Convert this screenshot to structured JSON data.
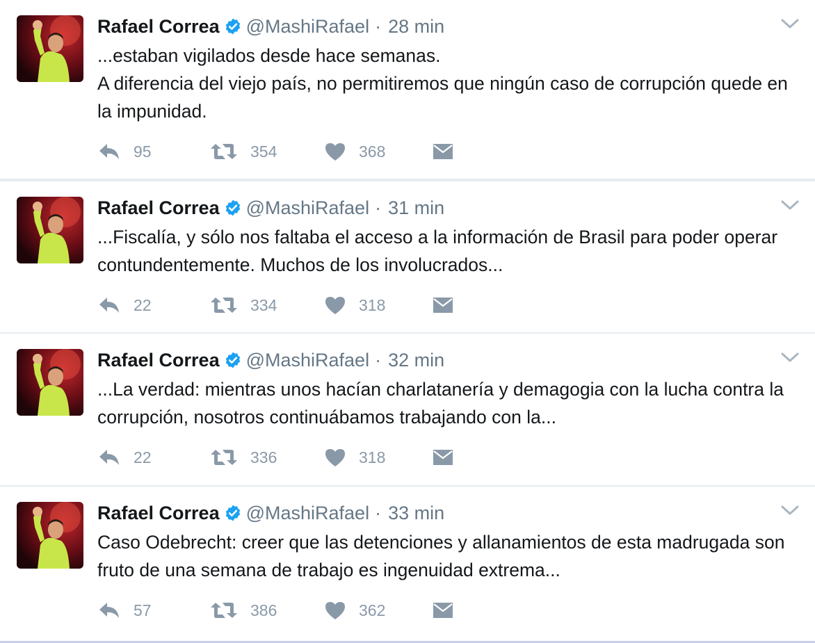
{
  "colors": {
    "text": "#14171a",
    "muted": "#657786",
    "icon": "#8a99a8",
    "verified": "#1da1f2",
    "divider": "#e6ecf0"
  },
  "tweets": [
    {
      "name": "Rafael Correa",
      "handle": "@MashiRafael",
      "separator": "·",
      "time": "28 min",
      "text": "...estaban vigilados desde hace semanas.\nA diferencia del viejo país, no permitiremos que ningún caso de corrupción quede en la impunidad.",
      "replies": "95",
      "retweets": "354",
      "likes": "368"
    },
    {
      "name": "Rafael Correa",
      "handle": "@MashiRafael",
      "separator": "·",
      "time": "31 min",
      "text": "...Fiscalía, y sólo nos faltaba el acceso a la información de Brasil para poder operar contundentemente. Muchos de los involucrados...",
      "replies": "22",
      "retweets": "334",
      "likes": "318"
    },
    {
      "name": "Rafael Correa",
      "handle": "@MashiRafael",
      "separator": "·",
      "time": "32 min",
      "text": "...La verdad: mientras unos hacían charlatanería y demagogia con la lucha contra la corrupción, nosotros continuábamos trabajando con la...",
      "replies": "22",
      "retweets": "336",
      "likes": "318"
    },
    {
      "name": "Rafael Correa",
      "handle": "@MashiRafael",
      "separator": "·",
      "time": "33 min",
      "text": "Caso Odebrecht: creer que las detenciones y allanamientos de esta madrugada son fruto de  una semana de trabajo es ingenuidad extrema...",
      "replies": "57",
      "retweets": "386",
      "likes": "362"
    }
  ],
  "icons": {
    "verified": "verified-badge-icon",
    "caret": "chevron-down-icon",
    "reply": "reply-icon",
    "retweet": "retweet-icon",
    "like": "heart-icon",
    "dm": "envelope-icon"
  }
}
